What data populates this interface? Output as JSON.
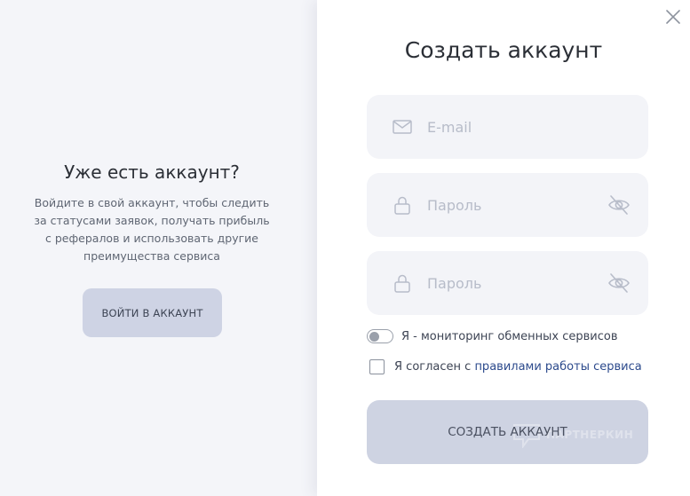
{
  "login_panel": {
    "heading": "Уже есть аккаунт?",
    "description": "Войдите в свой аккаунт, чтобы следить за статусами заявок, получать прибыль с рефералов и использовать другие преимущества сервиса",
    "login_button": "ВОЙТИ В АККАУНТ"
  },
  "register_panel": {
    "title": "Создать аккаунт",
    "email": {
      "placeholder": "E-mail",
      "value": "",
      "icon": "mail-icon"
    },
    "password": {
      "placeholder": "Пароль",
      "value": "",
      "icon": "lock-icon",
      "visibility_icon": "eye-off-icon"
    },
    "password_confirm": {
      "placeholder": "Пароль",
      "value": "",
      "icon": "lock-icon",
      "visibility_icon": "eye-off-icon"
    },
    "monitoring_toggle": {
      "label": "Я - мониторинг обменных сервисов",
      "on": false
    },
    "agree": {
      "prefix": "Я согласен с ",
      "link": "правилами работы сервиса",
      "checked": false
    },
    "create_button": "СОЗДАТЬ АККАУНТ",
    "watermark": "ПАРТНЕРКИН",
    "close_icon": "close-icon"
  },
  "colors": {
    "left_bg": "#f4f5f9",
    "field_bg": "#f3f4f8",
    "button_bg": "#ced3e2",
    "link": "#2c4a8c",
    "text_dark": "#2b2f36",
    "placeholder": "#b7bcc9"
  }
}
